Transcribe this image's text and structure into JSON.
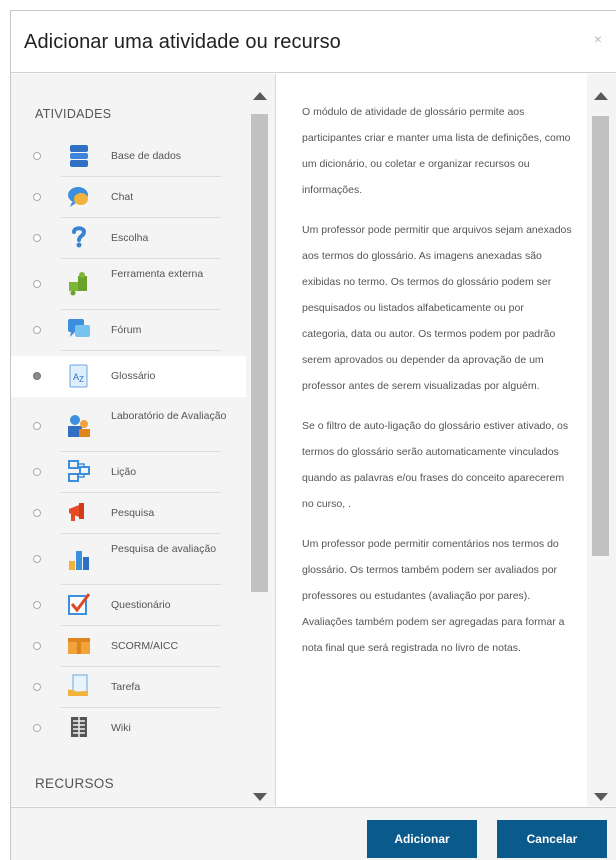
{
  "dialog": {
    "title": "Adicionar uma atividade ou recurso",
    "close": "×"
  },
  "sections": {
    "activities": "ATIVIDADES",
    "resources": "RECURSOS"
  },
  "items": [
    {
      "label": "Base de dados",
      "icon": "database-icon"
    },
    {
      "label": "Chat",
      "icon": "chat-icon"
    },
    {
      "label": "Escolha",
      "icon": "question-icon"
    },
    {
      "label": "Ferramenta externa",
      "icon": "puzzle-icon"
    },
    {
      "label": "Fórum",
      "icon": "forum-icon"
    },
    {
      "label": "Glossário",
      "icon": "glossary-icon",
      "selected": true
    },
    {
      "label": "Laboratório de Avaliação",
      "icon": "workshop-icon"
    },
    {
      "label": "Lição",
      "icon": "lesson-icon"
    },
    {
      "label": "Pesquisa",
      "icon": "megaphone-icon"
    },
    {
      "label": "Pesquisa de avaliação",
      "icon": "bar-chart-icon"
    },
    {
      "label": "Questionário",
      "icon": "quiz-check-icon"
    },
    {
      "label": "SCORM/AICC",
      "icon": "package-icon"
    },
    {
      "label": "Tarefa",
      "icon": "assignment-icon"
    },
    {
      "label": "Wiki",
      "icon": "wiki-icon"
    }
  ],
  "description": [
    "O módulo de atividade de glossário permite aos participantes criar e manter uma lista de definições, como um dicionário, ou coletar e organizar recursos ou informações.",
    "Um professor pode permitir que arquivos sejam anexados aos termos do glossário. As imagens anexadas são exibidas no termo. Os termos do glossário podem ser pesquisados ou listados alfabeticamente ou por categoria, data ou autor. Os termos podem por padrão serem aprovados ou depender da aprovação de um professor antes de serem visualizadas por alguém.",
    "Se o filtro de auto-ligação do glossário estiver ativado, os termos do glossário serão automaticamente vinculados quando as palavras e/ou frases do conceito aparecerem no curso, .",
    "Um professor pode permitir comentários nos termos do glossário. Os termos também podem ser avaliados por professores ou estudantes (avaliação por pares). Avaliações também podem ser agregadas para formar a nota final que será registrada no livro de notas."
  ],
  "buttons": {
    "add": "Adicionar",
    "cancel": "Cancelar"
  }
}
